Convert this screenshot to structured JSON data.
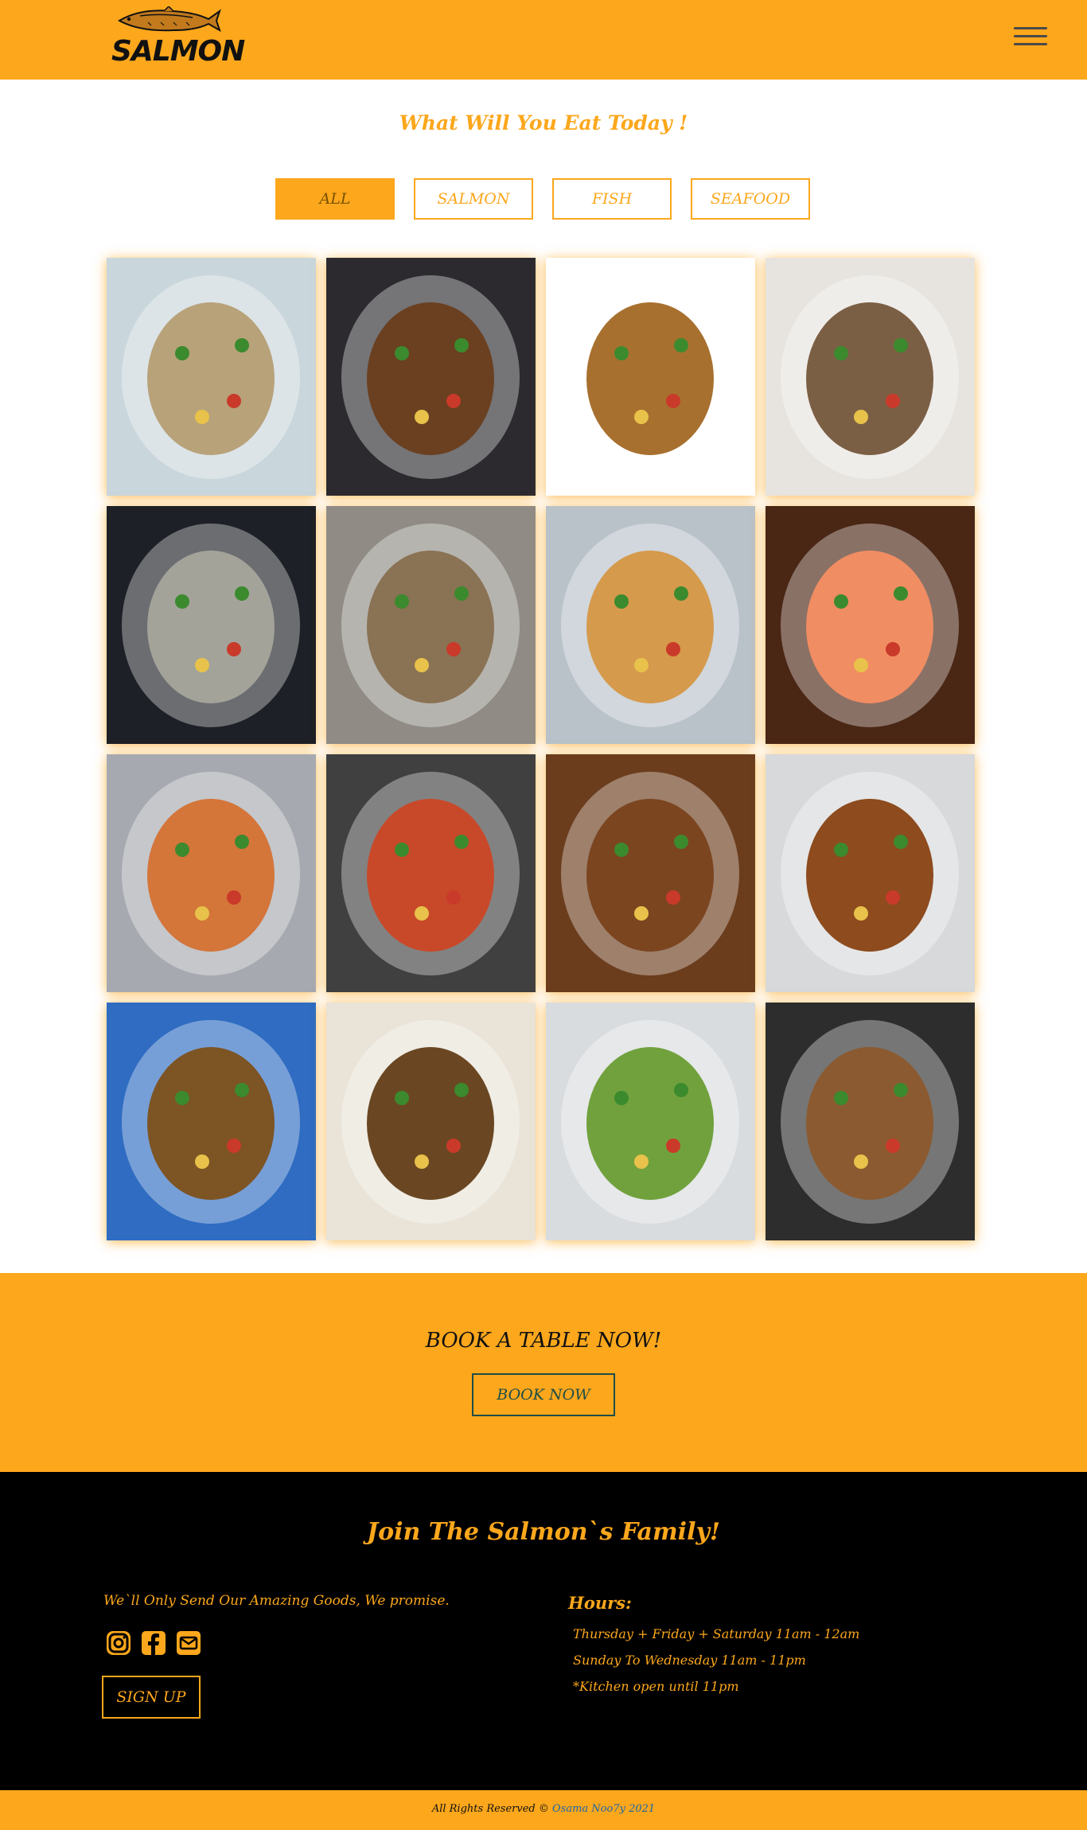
{
  "header": {
    "logo_text": "SALMON",
    "logo_icon": "fish-icon",
    "menu_icon": "hamburger-menu-icon"
  },
  "hero": {
    "title": "What Will You Eat Today !"
  },
  "filters": [
    {
      "label": "ALL",
      "active": true
    },
    {
      "label": "SALMON",
      "active": false
    },
    {
      "label": "FISH",
      "active": false
    },
    {
      "label": "SEAFOOD",
      "active": false
    }
  ],
  "gallery": {
    "items": [
      {
        "dish": "grilled-fish-asparagus",
        "bg": "#c9d6dc",
        "food": "#b8a27a"
      },
      {
        "dish": "grilled-fish-banana-leaf",
        "bg": "#2c2a2f",
        "food": "#6a4020"
      },
      {
        "dish": "fried-fish-plate",
        "bg": "#ffffff",
        "food": "#a8702f"
      },
      {
        "dish": "baked-trout-tray",
        "bg": "#e7e4df",
        "food": "#7b5f45"
      },
      {
        "dish": "roasted-fish-dark-tray",
        "bg": "#1d2026",
        "food": "#a3a39a"
      },
      {
        "dish": "whole-fish-platter",
        "bg": "#908c85",
        "food": "#8a7254"
      },
      {
        "dish": "salmon-fillet-pan",
        "bg": "#b9c2c9",
        "food": "#d59a4c"
      },
      {
        "dish": "smoked-salmon-board",
        "bg": "#4a2614",
        "food": "#f18d62"
      },
      {
        "dish": "glazed-salmon-rice",
        "bg": "#a6aab0",
        "food": "#d4753a"
      },
      {
        "dish": "lobster-paella",
        "bg": "#404040",
        "food": "#c8492a"
      },
      {
        "dish": "shrimp-gumbo-rice",
        "bg": "#6b3d1d",
        "food": "#7b4520"
      },
      {
        "dish": "shrimp-gumbo-bowl",
        "bg": "#d7d9db",
        "food": "#8d4b1e"
      },
      {
        "dish": "gumbo-pot",
        "bg": "#2f6cc2",
        "food": "#7d5424"
      },
      {
        "dish": "gumbo-white-bowl",
        "bg": "#e9e3d8",
        "food": "#6a4722"
      },
      {
        "dish": "green-curry-pot",
        "bg": "#d9dcdf",
        "food": "#71a13d"
      },
      {
        "dish": "sausage-seafood-stew",
        "bg": "#2d2d2d",
        "food": "#8b5a30"
      }
    ]
  },
  "book": {
    "title": "BOOK A TABLE NOW!",
    "button": "BOOK NOW"
  },
  "footer": {
    "join_title": "Join The Salmon`s Family!",
    "promise": "We`ll Only Send Our Amazing Goods, We promise.",
    "socials": [
      "instagram-icon",
      "facebook-icon",
      "email-icon"
    ],
    "signup": "SIGN UP",
    "hours_title": "Hours:",
    "hours": [
      "Thursday + Friday + Saturday 11am - 12am",
      "Sunday To Wednesday 11am - 11pm",
      "*Kitchen open until 11pm"
    ]
  },
  "copyright": {
    "text": "All Rights Reserved ©",
    "author": "Osama Noo7y 2021"
  },
  "colors": {
    "accent": "#fca71c",
    "dark": "#000000",
    "teal": "#1d4d49",
    "link": "#1d66a8"
  }
}
